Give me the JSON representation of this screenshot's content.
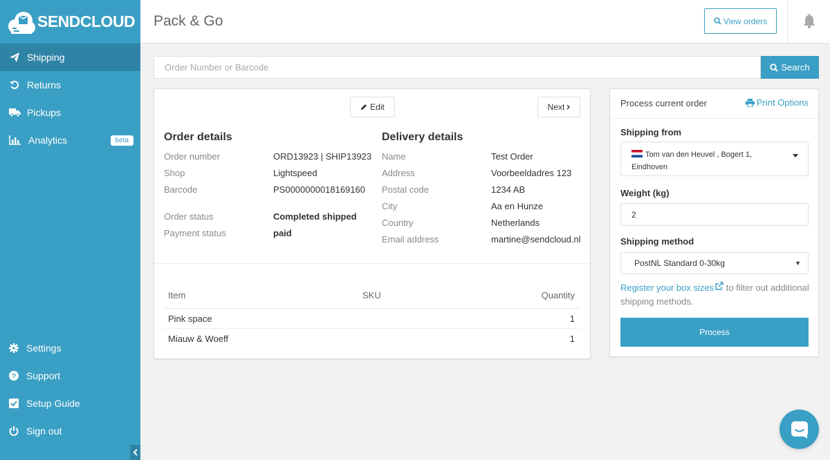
{
  "brand": {
    "name": "SENDCLOUD",
    "accent": "#3a9fc4"
  },
  "sidebar": {
    "items": [
      {
        "label": "Shipping",
        "icon": "paper-plane-icon",
        "active": true
      },
      {
        "label": "Returns",
        "icon": "undo-icon"
      },
      {
        "label": "Pickups",
        "icon": "truck-icon"
      },
      {
        "label": "Analytics",
        "icon": "bar-chart-icon",
        "badge": "beta"
      }
    ],
    "bottom_items": [
      {
        "label": "Settings",
        "icon": "gear-icon"
      },
      {
        "label": "Support",
        "icon": "question-circle-icon"
      },
      {
        "label": "Setup Guide",
        "icon": "check-square-icon"
      },
      {
        "label": "Sign out",
        "icon": "power-icon"
      }
    ]
  },
  "header": {
    "title": "Pack & Go",
    "view_orders_label": "View orders"
  },
  "search": {
    "placeholder": "Order Number or Barcode",
    "button_label": "Search"
  },
  "order": {
    "edit_label": "Edit",
    "next_label": "Next",
    "order_details_title": "Order details",
    "delivery_details_title": "Delivery details",
    "order_fields": [
      {
        "label": "Order number",
        "value": "ORD13923 | SHIP13923"
      },
      {
        "label": "Shop",
        "value": "Lightspeed"
      },
      {
        "label": "Barcode",
        "value": "PS0000000018169160"
      },
      {
        "label": "Order status",
        "value": "Completed shipped"
      },
      {
        "label": "Payment status",
        "value": "paid"
      }
    ],
    "delivery_fields": [
      {
        "label": "Name",
        "value": "Test Order"
      },
      {
        "label": "Address",
        "value": "Voorbeeldadres 123"
      },
      {
        "label": "Postal code",
        "value": "1234 AB"
      },
      {
        "label": "City",
        "value": "Aa en Hunze"
      },
      {
        "label": "Country",
        "value": "Netherlands"
      },
      {
        "label": "Email address",
        "value": "martine@sendcloud.nl"
      }
    ],
    "items_columns": [
      "Item",
      "SKU",
      "Quantity"
    ],
    "items": [
      {
        "item": "Pink space",
        "sku": "",
        "quantity": "1"
      },
      {
        "item": "Miauw & Woeff",
        "sku": "",
        "quantity": "1"
      }
    ]
  },
  "process": {
    "heading": "Process current order",
    "print_options_label": "Print Options",
    "shipping_from_label": "Shipping from",
    "shipping_from_line1": "Tom van den Heuvel , Bogert 1,",
    "shipping_from_line2": "Eindhoven",
    "weight_label": "Weight (kg)",
    "weight_value": "2",
    "shipping_method_label": "Shipping method",
    "shipping_method_value": "PostNL Standard 0-30kg",
    "register_link": "Register your box sizes",
    "register_rest": " to filter out additional shipping methods.",
    "process_button": "Process"
  }
}
